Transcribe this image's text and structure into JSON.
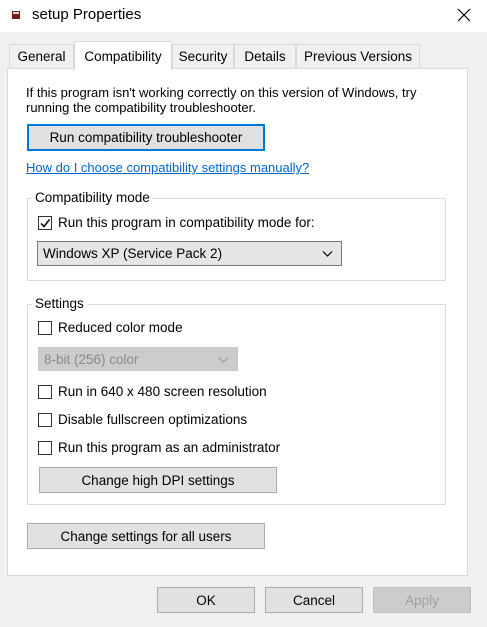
{
  "window": {
    "title": "setup Properties"
  },
  "tabs": [
    {
      "label": "General"
    },
    {
      "label": "Compatibility"
    },
    {
      "label": "Security"
    },
    {
      "label": "Details"
    },
    {
      "label": "Previous Versions"
    }
  ],
  "active_tab": "Compatibility",
  "compat": {
    "intro": "If this program isn't working correctly on this version of Windows, try running the compatibility troubleshooter.",
    "troubleshooter_button": "Run compatibility troubleshooter",
    "help_link": "How do I choose compatibility settings manually?",
    "mode_group": {
      "label": "Compatibility mode",
      "checkbox_label": "Run this program in compatibility mode for:",
      "checked": true,
      "selected_os": "Windows XP (Service Pack 2)"
    },
    "settings_group": {
      "label": "Settings",
      "reduced_color_label": "Reduced color mode",
      "reduced_color_checked": false,
      "color_depth_value": "8-bit (256) color",
      "resolution_label": "Run in 640 x 480 screen resolution",
      "resolution_checked": false,
      "fullscreen_label": "Disable fullscreen optimizations",
      "fullscreen_checked": false,
      "admin_label": "Run this program as an administrator",
      "admin_checked": false,
      "dpi_button": "Change high DPI settings"
    },
    "all_users_button": "Change settings for all users"
  },
  "footer": {
    "ok": "OK",
    "cancel": "Cancel",
    "apply": "Apply"
  },
  "colors": {
    "link": "#0066cc",
    "focus": "#0078d7",
    "window_bg": "#f0f0f0"
  },
  "icons": {
    "app": "app-icon",
    "close": "close-icon",
    "check": "checkmark-icon",
    "dropdown": "chevron-down-icon"
  }
}
